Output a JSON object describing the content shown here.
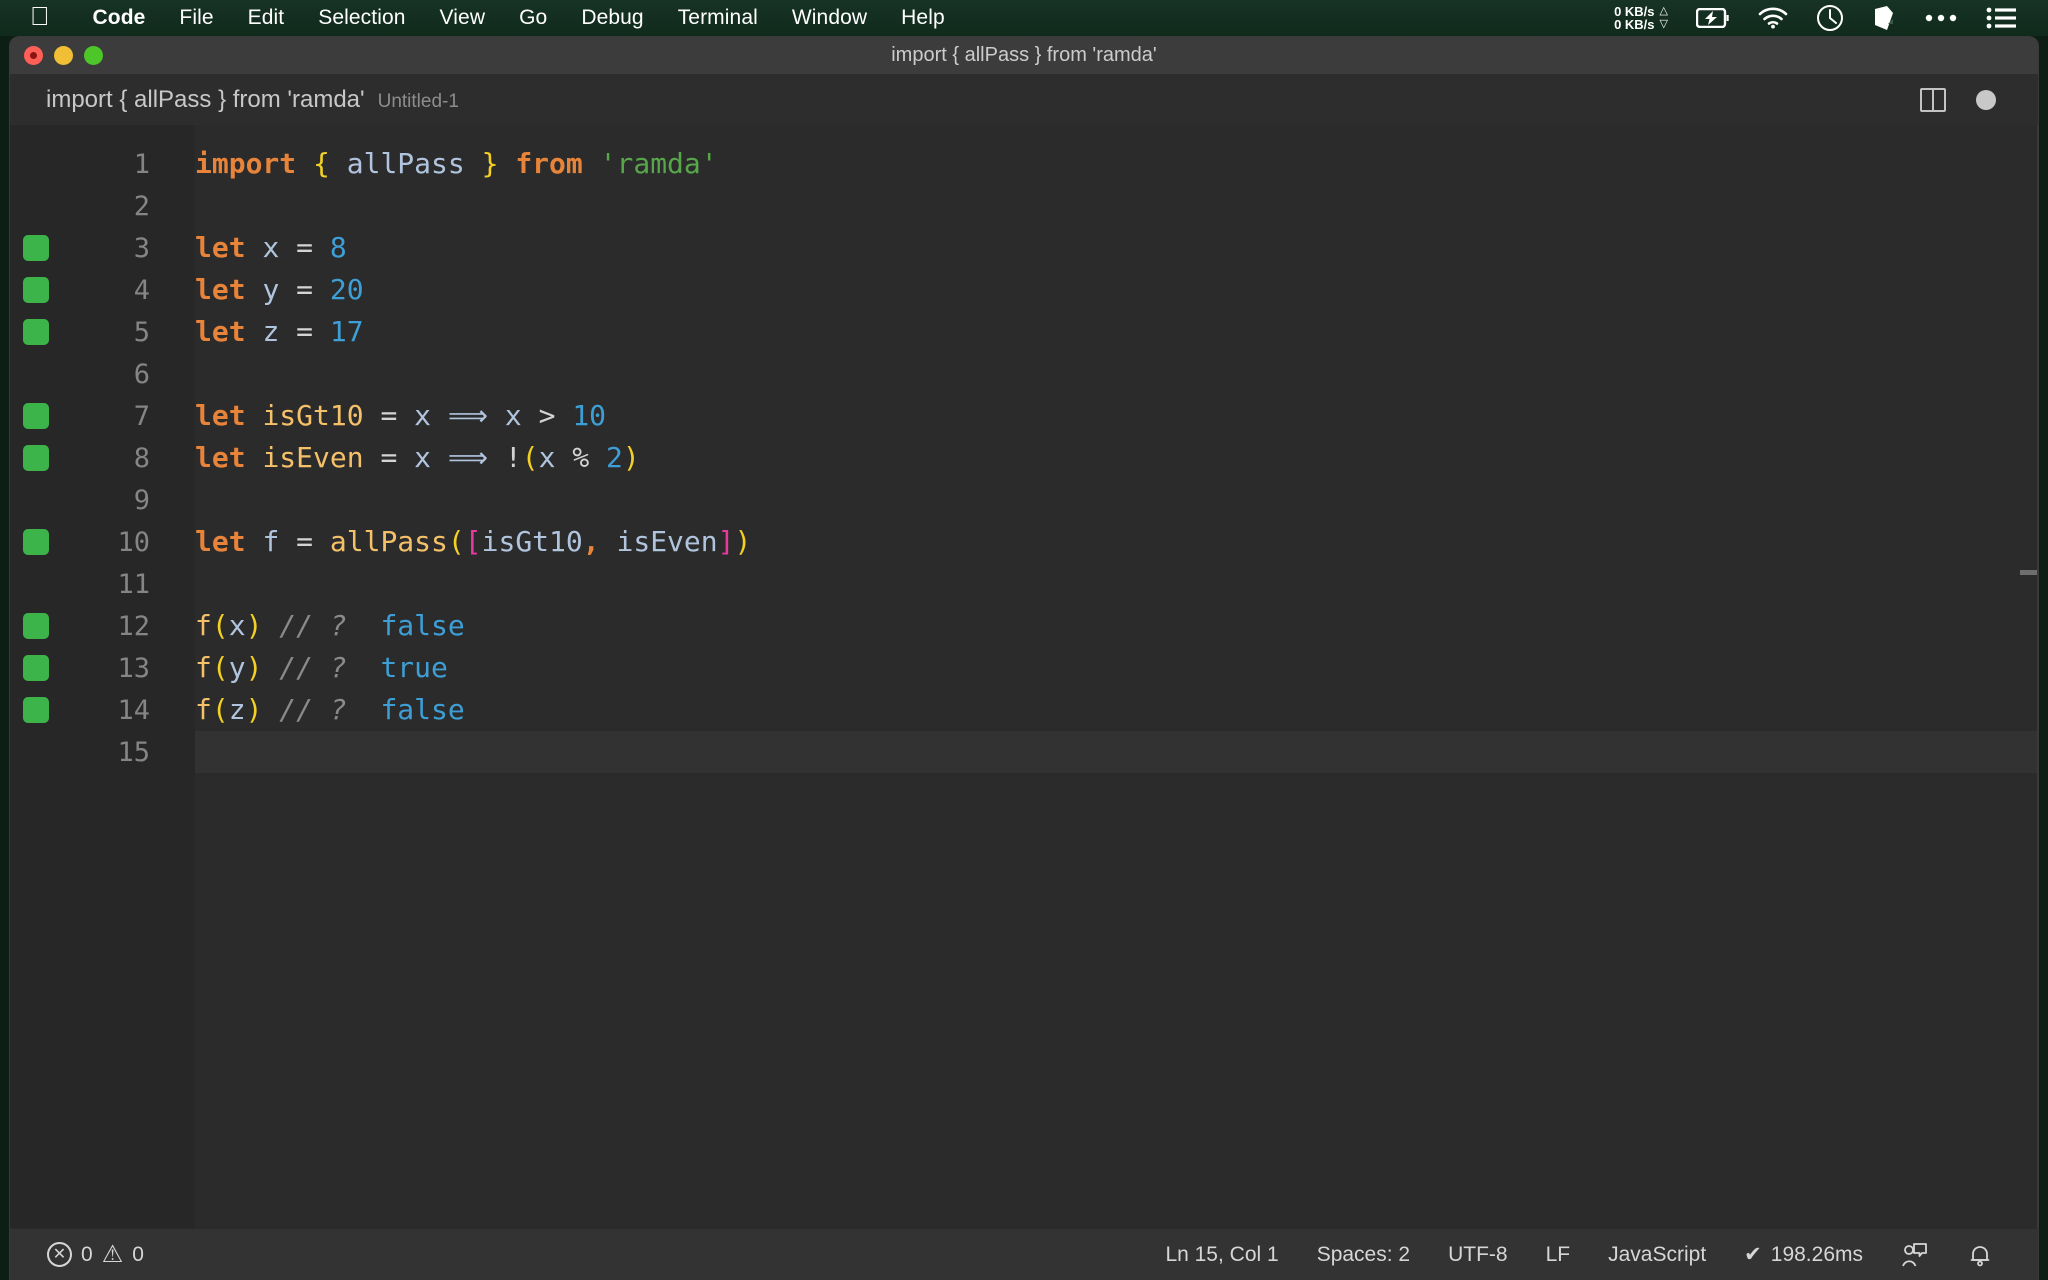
{
  "menubar": {
    "apple_icon": "apple-logo-icon",
    "items": [
      {
        "label": "Code",
        "bold": true
      },
      {
        "label": "File",
        "bold": false
      },
      {
        "label": "Edit",
        "bold": false
      },
      {
        "label": "Selection",
        "bold": false
      },
      {
        "label": "View",
        "bold": false
      },
      {
        "label": "Go",
        "bold": false
      },
      {
        "label": "Debug",
        "bold": false
      },
      {
        "label": "Terminal",
        "bold": false
      },
      {
        "label": "Window",
        "bold": false
      },
      {
        "label": "Help",
        "bold": false
      }
    ],
    "tray": {
      "network_up": "0 KB/s",
      "network_down": "0 KB/s",
      "up_arrow": "△",
      "down_arrow": "▽",
      "battery_icon": "battery-charging-icon",
      "wifi_icon": "wifi-icon",
      "clock_icon": "clock-icon",
      "dropbox_icon": "dropbox-icon",
      "ellipsis_icon": "ellipsis-icon",
      "list_icon": "control-center-list-icon"
    },
    "bg_color": "#173326"
  },
  "window": {
    "title": "import { allPass } from 'ramda'",
    "traffic_lights": [
      "close-button",
      "minimize-button",
      "maximize-button"
    ]
  },
  "tabbar": {
    "tab_label": "import { allPass } from 'ramda'",
    "tab_sublabel": "Untitled-1",
    "split_editor_icon": "split-editor-icon",
    "dirty_indicator": "unsaved-changes-dot"
  },
  "editor": {
    "lines": [
      {
        "number": "1",
        "marker": false,
        "current": false,
        "tokens": [
          {
            "t": "import",
            "c": "kw"
          },
          {
            "t": " ",
            "c": "punc"
          },
          {
            "t": "{",
            "c": "brace"
          },
          {
            "t": " ",
            "c": "punc"
          },
          {
            "t": "allPass",
            "c": "ident"
          },
          {
            "t": " ",
            "c": "punc"
          },
          {
            "t": "}",
            "c": "brace"
          },
          {
            "t": " ",
            "c": "punc"
          },
          {
            "t": "from",
            "c": "kw"
          },
          {
            "t": " ",
            "c": "punc"
          },
          {
            "t": "'ramda'",
            "c": "str"
          }
        ]
      },
      {
        "number": "2",
        "marker": false,
        "current": false,
        "tokens": []
      },
      {
        "number": "3",
        "marker": true,
        "current": false,
        "tokens": [
          {
            "t": "let",
            "c": "kw"
          },
          {
            "t": " ",
            "c": "punc"
          },
          {
            "t": "x",
            "c": "ident"
          },
          {
            "t": " ",
            "c": "punc"
          },
          {
            "t": "=",
            "c": "op"
          },
          {
            "t": " ",
            "c": "punc"
          },
          {
            "t": "8",
            "c": "num"
          }
        ]
      },
      {
        "number": "4",
        "marker": true,
        "current": false,
        "tokens": [
          {
            "t": "let",
            "c": "kw"
          },
          {
            "t": " ",
            "c": "punc"
          },
          {
            "t": "y",
            "c": "ident"
          },
          {
            "t": " ",
            "c": "punc"
          },
          {
            "t": "=",
            "c": "op"
          },
          {
            "t": " ",
            "c": "punc"
          },
          {
            "t": "20",
            "c": "num"
          }
        ]
      },
      {
        "number": "5",
        "marker": true,
        "current": false,
        "tokens": [
          {
            "t": "let",
            "c": "kw"
          },
          {
            "t": " ",
            "c": "punc"
          },
          {
            "t": "z",
            "c": "ident"
          },
          {
            "t": " ",
            "c": "punc"
          },
          {
            "t": "=",
            "c": "op"
          },
          {
            "t": " ",
            "c": "punc"
          },
          {
            "t": "17",
            "c": "num"
          }
        ]
      },
      {
        "number": "6",
        "marker": false,
        "current": false,
        "tokens": []
      },
      {
        "number": "7",
        "marker": true,
        "current": false,
        "tokens": [
          {
            "t": "let",
            "c": "kw"
          },
          {
            "t": " ",
            "c": "punc"
          },
          {
            "t": "isGt10",
            "c": "fn"
          },
          {
            "t": " ",
            "c": "punc"
          },
          {
            "t": "=",
            "c": "op"
          },
          {
            "t": " ",
            "c": "punc"
          },
          {
            "t": "x",
            "c": "ident"
          },
          {
            "t": " ",
            "c": "punc"
          },
          {
            "t": "⟹",
            "c": "arrow"
          },
          {
            "t": " ",
            "c": "punc"
          },
          {
            "t": "x",
            "c": "ident"
          },
          {
            "t": " ",
            "c": "punc"
          },
          {
            "t": ">",
            "c": "op"
          },
          {
            "t": " ",
            "c": "punc"
          },
          {
            "t": "10",
            "c": "num"
          }
        ]
      },
      {
        "number": "8",
        "marker": true,
        "current": false,
        "tokens": [
          {
            "t": "let",
            "c": "kw"
          },
          {
            "t": " ",
            "c": "punc"
          },
          {
            "t": "isEven",
            "c": "fn"
          },
          {
            "t": " ",
            "c": "punc"
          },
          {
            "t": "=",
            "c": "op"
          },
          {
            "t": " ",
            "c": "punc"
          },
          {
            "t": "x",
            "c": "ident"
          },
          {
            "t": " ",
            "c": "punc"
          },
          {
            "t": "⟹",
            "c": "arrow"
          },
          {
            "t": " ",
            "c": "punc"
          },
          {
            "t": "!",
            "c": "op"
          },
          {
            "t": "(",
            "c": "brace"
          },
          {
            "t": "x",
            "c": "ident"
          },
          {
            "t": " ",
            "c": "punc"
          },
          {
            "t": "%",
            "c": "op"
          },
          {
            "t": " ",
            "c": "punc"
          },
          {
            "t": "2",
            "c": "num"
          },
          {
            "t": ")",
            "c": "brace"
          }
        ]
      },
      {
        "number": "9",
        "marker": false,
        "current": false,
        "tokens": []
      },
      {
        "number": "10",
        "marker": true,
        "current": false,
        "tokens": [
          {
            "t": "let",
            "c": "kw"
          },
          {
            "t": " ",
            "c": "punc"
          },
          {
            "t": "f",
            "c": "ident"
          },
          {
            "t": " ",
            "c": "punc"
          },
          {
            "t": "=",
            "c": "op"
          },
          {
            "t": " ",
            "c": "punc"
          },
          {
            "t": "allPass",
            "c": "fn"
          },
          {
            "t": "(",
            "c": "brace"
          },
          {
            "t": "[",
            "c": "brack"
          },
          {
            "t": "isGt10",
            "c": "ident"
          },
          {
            "t": ",",
            "c": "kw"
          },
          {
            "t": " ",
            "c": "punc"
          },
          {
            "t": "isEven",
            "c": "ident"
          },
          {
            "t": "]",
            "c": "brack"
          },
          {
            "t": ")",
            "c": "brace"
          }
        ]
      },
      {
        "number": "11",
        "marker": false,
        "current": false,
        "tokens": []
      },
      {
        "number": "12",
        "marker": true,
        "current": false,
        "tokens": [
          {
            "t": "f",
            "c": "fn"
          },
          {
            "t": "(",
            "c": "brace"
          },
          {
            "t": "x",
            "c": "ident"
          },
          {
            "t": ")",
            "c": "brace"
          },
          {
            "t": " ",
            "c": "punc"
          },
          {
            "t": "// ?",
            "c": "cmt"
          },
          {
            "t": "  ",
            "c": "punc"
          },
          {
            "t": "false",
            "c": "bool"
          }
        ]
      },
      {
        "number": "13",
        "marker": true,
        "current": false,
        "tokens": [
          {
            "t": "f",
            "c": "fn"
          },
          {
            "t": "(",
            "c": "brace"
          },
          {
            "t": "y",
            "c": "ident"
          },
          {
            "t": ")",
            "c": "brace"
          },
          {
            "t": " ",
            "c": "punc"
          },
          {
            "t": "// ?",
            "c": "cmt"
          },
          {
            "t": "  ",
            "c": "punc"
          },
          {
            "t": "true",
            "c": "bool"
          }
        ]
      },
      {
        "number": "14",
        "marker": true,
        "current": false,
        "tokens": [
          {
            "t": "f",
            "c": "fn"
          },
          {
            "t": "(",
            "c": "brace"
          },
          {
            "t": "z",
            "c": "ident"
          },
          {
            "t": ")",
            "c": "brace"
          },
          {
            "t": " ",
            "c": "punc"
          },
          {
            "t": "// ?",
            "c": "cmt"
          },
          {
            "t": "  ",
            "c": "punc"
          },
          {
            "t": "false",
            "c": "bool"
          }
        ]
      },
      {
        "number": "15",
        "marker": false,
        "current": true,
        "tokens": []
      }
    ],
    "colors": {
      "background": "#2b2b2b",
      "gutter": "#272727",
      "keyword": "#e8833a",
      "function": "#f5c06a",
      "number": "#3d9fd6",
      "string": "#57a64a",
      "brace": "#f2d024",
      "bracket": "#e8399c",
      "comment": "#8a8a8a",
      "marker_green": "#3cb44a"
    }
  },
  "statusbar": {
    "error_icon": "error-circle-icon",
    "error_count": "0",
    "warning_icon": "warning-triangle-icon",
    "warning_count": "0",
    "cursor_position": "Ln 15, Col 1",
    "indentation": "Spaces: 2",
    "encoding": "UTF-8",
    "eol": "LF",
    "language": "JavaScript",
    "quokka_check": "✔",
    "quokka_time": "198.26ms",
    "feedback_icon": "feedback-person-icon",
    "bell_icon": "notifications-bell-icon"
  }
}
